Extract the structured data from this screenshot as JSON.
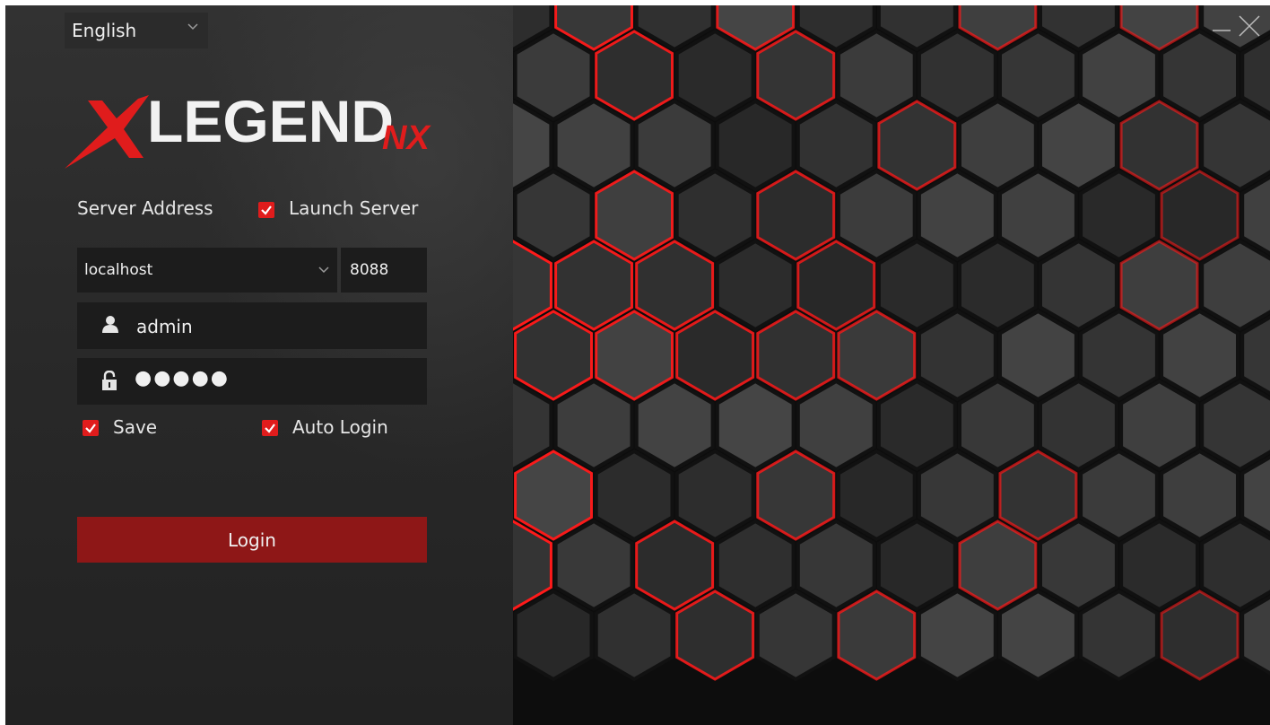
{
  "language": {
    "selected": "English"
  },
  "logo": {
    "text_main": "LEGEND",
    "text_suffix": "NX"
  },
  "server": {
    "label": "Server Address",
    "launch_server_label": "Launch Server",
    "launch_server_checked": true,
    "address_value": "localhost",
    "port_value": "8088"
  },
  "credentials": {
    "username_value": "admin",
    "password_masked": "●●●●●"
  },
  "options": {
    "save_label": "Save",
    "save_checked": true,
    "auto_login_label": "Auto Login",
    "auto_login_checked": true
  },
  "actions": {
    "login_label": "Login"
  },
  "window_controls": {
    "minimize_icon": "minimize-icon",
    "close_icon": "close-icon"
  },
  "colors": {
    "accent_red": "#e01c1c",
    "button_red": "#8e1717",
    "panel_bg": "#2a2a2a",
    "field_bg": "#1c1c1c"
  }
}
